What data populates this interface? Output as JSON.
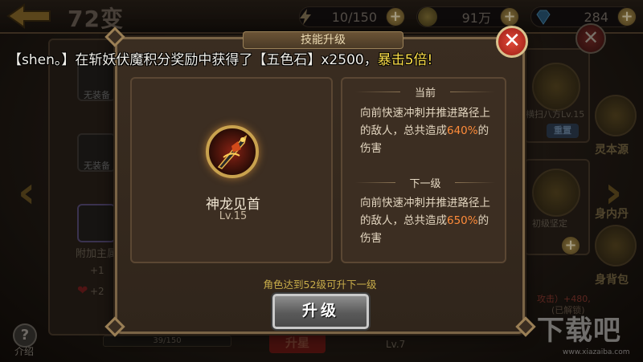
{
  "top": {
    "title": "72变",
    "energy": "10/150",
    "gold": "91万",
    "diamond": "284"
  },
  "background": {
    "slot_label_1": "无装备",
    "slot_label_2": "无装备",
    "extra_main": "附加主属",
    "stat_1": "+1",
    "stat_2": "+2",
    "help_label": "介绍",
    "progress_text": "39/150",
    "upgrade_bg": "升星",
    "right_skill_name": "横扫八方Lv.15",
    "reset_button": "重置",
    "right_source": "灵本源",
    "right_skill2": "初级坚定",
    "right_inner": "身内丹",
    "right_backpack": "身背包",
    "right_attack": "攻击）+480,",
    "right_unlocked": "(已解锁)",
    "level7": "Lv.7"
  },
  "modal": {
    "banner": "技能升级",
    "skill_name": "神龙见首",
    "skill_level": "Lv.15",
    "current_head": "当前",
    "current_desc_a": "向前快速冲刺并推进路径上的敌人，总共造成",
    "current_value": "640",
    "current_desc_b": "%的伤害",
    "next_head": "下一级",
    "next_desc_a": "向前快速冲刺并推进路径上的敌人，总共造成",
    "next_value": "650",
    "next_desc_b": "%的伤害",
    "requirement": "角色达到52级可升下一级",
    "upgrade_button": "升级"
  },
  "notice": {
    "part1": "【shen。】在斩妖伏魔积分奖励中获得了",
    "item": "【五色石】",
    "part2": "x2500，",
    "crit": "暴击5倍!"
  },
  "watermark": {
    "main": "下载吧",
    "sub": "www.xiazaiba.com"
  },
  "colors": {
    "accent_gold": "#c9ad4a",
    "value_orange": "#ff8c3a",
    "notice_yellow": "#ffe14a",
    "close_red": "#e24a3a"
  }
}
